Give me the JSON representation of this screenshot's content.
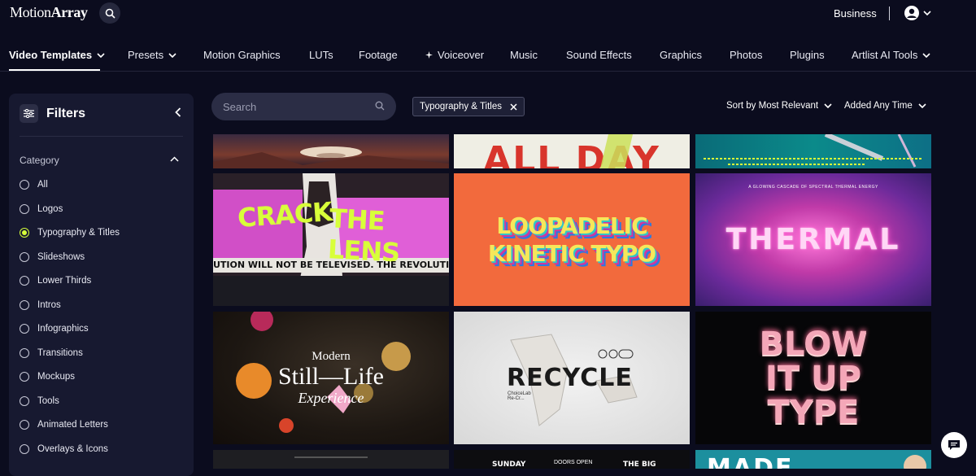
{
  "header": {
    "logo_main": "Motion",
    "logo_bold": "Array",
    "business_label": "Business",
    "icons": {
      "search": "search-icon",
      "user": "user-icon",
      "caret": "chevron-down-icon"
    }
  },
  "nav": {
    "items": [
      {
        "label": "Video Templates",
        "active": true,
        "has_caret": true
      },
      {
        "label": "Presets",
        "has_caret": true
      },
      {
        "label": "Motion Graphics"
      },
      {
        "label": "LUTs"
      },
      {
        "label": "Footage"
      },
      {
        "label": "Voiceover",
        "icon": "sparkle-icon"
      },
      {
        "label": "Music"
      },
      {
        "label": "Sound Effects"
      },
      {
        "label": "Graphics"
      },
      {
        "label": "Photos"
      },
      {
        "label": "Plugins"
      },
      {
        "label": "Artlist AI Tools",
        "has_caret": true
      }
    ]
  },
  "sidebar": {
    "title": "Filters",
    "category_label": "Category",
    "categories": [
      {
        "label": "All",
        "checked": false
      },
      {
        "label": "Logos",
        "checked": false
      },
      {
        "label": "Typography & Titles",
        "checked": true
      },
      {
        "label": "Slideshows",
        "checked": false
      },
      {
        "label": "Lower Thirds",
        "checked": false
      },
      {
        "label": "Intros",
        "checked": false
      },
      {
        "label": "Infographics",
        "checked": false
      },
      {
        "label": "Transitions",
        "checked": false
      },
      {
        "label": "Mockups",
        "checked": false
      },
      {
        "label": "Tools",
        "checked": false
      },
      {
        "label": "Animated Letters",
        "checked": false
      },
      {
        "label": "Overlays & Icons",
        "checked": false
      }
    ]
  },
  "toolbar": {
    "search_placeholder": "Search",
    "active_filter": "Typography & Titles",
    "sort_label": "Sort by Most Relevant",
    "time_label": "Added Any Time"
  },
  "grid": {
    "row0": [
      {
        "text": ""
      },
      {
        "text": "ALL DAY"
      },
      {
        "text": ""
      }
    ],
    "row1": [
      {
        "line1": "CRACK",
        "line2": "THE LENS",
        "ticker": "UTION WILL NOT BE TELEVISED. THE REVOLUTION WILL NOT BE TELEVI"
      },
      {
        "line1": "LOOPADELIC",
        "line2": "KINETIC TYPO"
      },
      {
        "text": "THERMAL",
        "caption": "A GLOWING CASCADE OF SPECTRAL THERMAL ENERGY"
      }
    ],
    "row2": [
      {
        "small": "Modern",
        "line1": "Still—Life",
        "line2": "Experience"
      },
      {
        "text": "RECYCLE",
        "sub": "ChoiceLab\nRe-Cr..."
      },
      {
        "line1": "BLOW",
        "line2": "IT UP",
        "line3": "TYPE"
      }
    ],
    "row3": [
      {
        "text": ""
      },
      {
        "a": "SUNDAY",
        "b": "DOORS OPEN",
        "c": "THE BIG"
      },
      {
        "text": "MADE"
      }
    ]
  },
  "colors": {
    "background": "#0b0c1e",
    "sidebar": "#171930",
    "accent_radio": "#d6ff3a",
    "chip_bg": "#1e2036"
  }
}
